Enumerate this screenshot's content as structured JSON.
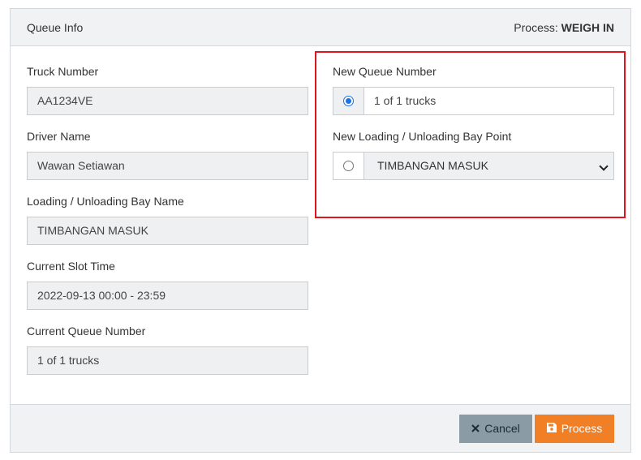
{
  "header": {
    "title": "Queue Info",
    "process_prefix": "Process:",
    "process_value": "WEIGH IN"
  },
  "left_fields": [
    {
      "label": "Truck Number",
      "value": "AA1234VE"
    },
    {
      "label": "Driver Name",
      "value": "Wawan Setiawan"
    },
    {
      "label": "Loading / Unloading Bay Name",
      "value": "TIMBANGAN MASUK"
    },
    {
      "label": "Current Slot Time",
      "value": "2022-09-13 00:00 - 23:59"
    },
    {
      "label": "Current Queue Number",
      "value": "1 of 1 trucks"
    }
  ],
  "new_queue": {
    "label": "New Queue Number",
    "value": "1 of 1 trucks",
    "selected": true
  },
  "new_bay": {
    "label": "New Loading / Unloading Bay Point",
    "value": "TIMBANGAN MASUK",
    "selected": false
  },
  "footer": {
    "cancel_label": "Cancel",
    "process_label": "Process"
  },
  "colors": {
    "highlight_border": "#e0151b",
    "process_button": "#f07f26",
    "cancel_button": "#8a9ba5",
    "radio_checked": "#1a73e8"
  },
  "icons": {
    "cancel": "close-icon",
    "process": "save-icon",
    "select": "chevron-down-icon"
  }
}
